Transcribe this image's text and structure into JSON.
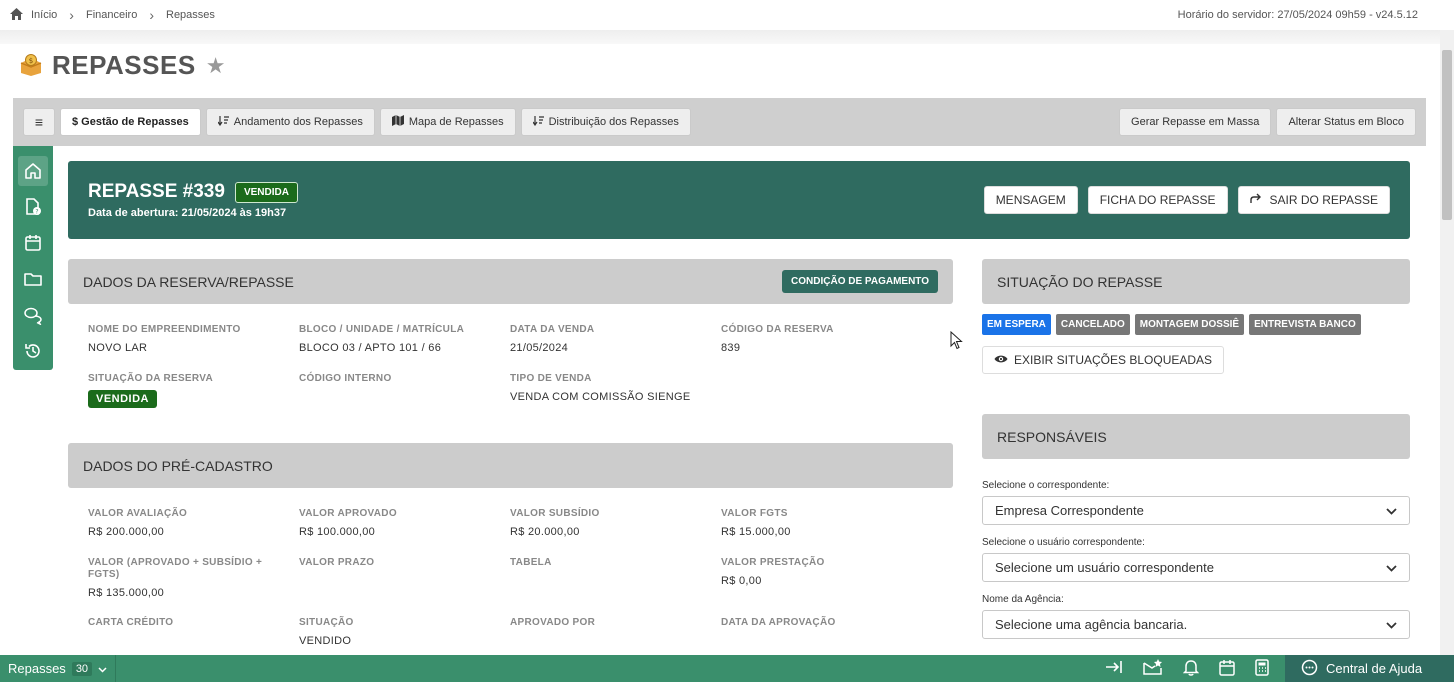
{
  "breadcrumb": {
    "home": "Início",
    "items": [
      "Financeiro",
      "Repasses"
    ]
  },
  "server_time": "Horário do servidor: 27/05/2024 09h59 - v24.5.12",
  "page": {
    "title": "REPASSES"
  },
  "tabs": [
    {
      "label": "$ Gestão de Repasses"
    },
    {
      "label": "Andamento dos Repasses"
    },
    {
      "label": "Mapa de Repasses"
    },
    {
      "label": "Distribuição dos Repasses"
    }
  ],
  "actions": {
    "mass": "Gerar Repasse em Massa",
    "bulk_status": "Alterar Status em Bloco"
  },
  "repasse": {
    "title": "REPASSE #339",
    "badge": "VENDIDA",
    "opened": "Data de abertura: 21/05/2024 às 19h37",
    "buttons": {
      "message": "MENSAGEM",
      "sheet": "FICHA DO REPASSE",
      "exit": "SAIR DO REPASSE"
    }
  },
  "reserva": {
    "heading": "DADOS DA RESERVA/REPASSE",
    "cond_button": "CONDIÇÃO DE PAGAMENTO",
    "fields": [
      {
        "label": "NOME DO EMPREENDIMENTO",
        "value": "NOVO LAR"
      },
      {
        "label": "BLOCO / UNIDADE / MATRÍCULA",
        "value": "BLOCO 03 / APTO 101 / 66"
      },
      {
        "label": "DATA DA VENDA",
        "value": "21/05/2024"
      },
      {
        "label": "CÓDIGO DA RESERVA",
        "value": "839"
      },
      {
        "label": "SITUAÇÃO DA RESERVA",
        "value": "VENDIDA"
      },
      {
        "label": "CÓDIGO INTERNO",
        "value": ""
      },
      {
        "label": "TIPO DE VENDA",
        "value": "VENDA COM COMISSÃO SIENGE"
      }
    ]
  },
  "precadastro": {
    "heading": "DADOS DO PRÉ-CADASTRO",
    "fields": [
      {
        "label": "VALOR AVALIAÇÃO",
        "value": "R$ 200.000,00"
      },
      {
        "label": "VALOR APROVADO",
        "value": "R$ 100.000,00"
      },
      {
        "label": "VALOR SUBSÍDIO",
        "value": "R$ 20.000,00"
      },
      {
        "label": "VALOR FGTS",
        "value": "R$ 15.000,00"
      },
      {
        "label": "VALOR (APROVADO + SUBSÍDIO + FGTS)",
        "value": "R$ 135.000,00"
      },
      {
        "label": "VALOR PRAZO",
        "value": ""
      },
      {
        "label": "TABELA",
        "value": ""
      },
      {
        "label": "VALOR PRESTAÇÃO",
        "value": "R$ 0,00"
      },
      {
        "label": "CARTA CRÉDITO",
        "value": ""
      },
      {
        "label": "SITUAÇÃO",
        "value": "VENDIDO"
      },
      {
        "label": "APROVADO POR",
        "value": ""
      },
      {
        "label": "DATA DA APROVAÇÃO",
        "value": ""
      }
    ]
  },
  "situacao": {
    "heading": "SITUAÇÃO DO REPASSE",
    "chips": [
      "EM ESPERA",
      "CANCELADO",
      "MONTAGEM DOSSIÊ",
      "ENTREVISTA BANCO"
    ],
    "show_blocked": "EXIBIR SITUAÇÕES BLOQUEADAS",
    "active_color": "#1a73e8"
  },
  "responsaveis": {
    "heading": "RESPONSÁVEIS",
    "correspondente_label": "Selecione o correspondente:",
    "correspondente_value": "Empresa Correspondente",
    "usuario_label": "Selecione o usuário correspondente:",
    "usuario_value": "Selecione um usuário correspondente",
    "agencia_label": "Nome da Agência:",
    "agencia_value": "Selecione uma agência bancaria."
  },
  "bottom": {
    "label": "Repasses",
    "count": "30",
    "help": "Central de Ajuda"
  },
  "colors": {
    "brand_green": "#3a8f6c",
    "header_teal": "#2f6b60",
    "badge_green": "#1b6b1b"
  }
}
